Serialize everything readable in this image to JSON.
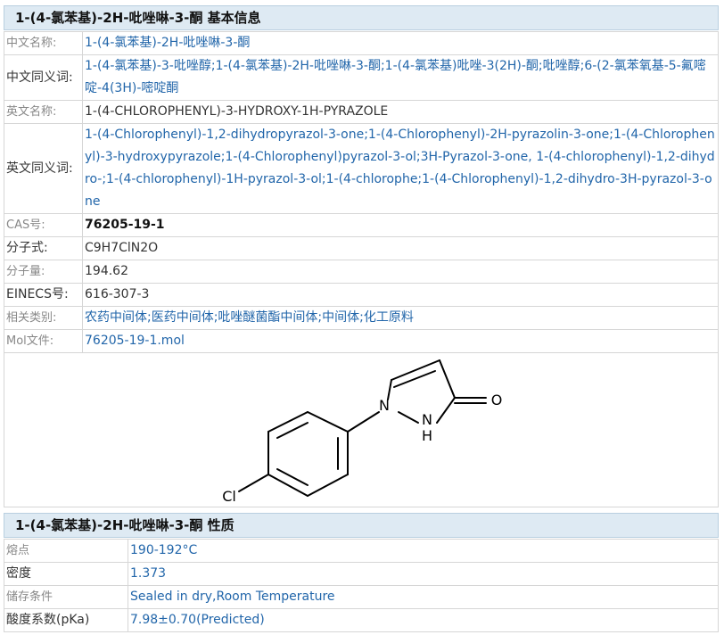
{
  "basic": {
    "title": "1-(4-氯苯基)-2H-吡唑啉-3-酮 基本信息",
    "rows": [
      {
        "label": "中文名称:",
        "value": "1-(4-氯苯基)-2H-吡唑啉-3-酮"
      },
      {
        "label": "中文同义词:",
        "value": "1-(4-氯苯基)-3-吡唑醇;1-(4-氯苯基)-2H-吡唑啉-3-酮;1-(4-氯苯基)吡唑-3(2H)-酮;吡唑醇;6-(2-氯苯氧基-5-氟嘧啶-4(3H)-嘧啶酮"
      },
      {
        "label": "英文名称:",
        "value": "1-(4-CHLOROPHENYL)-3-HYDROXY-1H-PYRAZOLE"
      },
      {
        "label": "英文同义词:",
        "value": "1-(4-Chlorophenyl)-1,2-dihydropyrazol-3-one;1-(4-Chlorophenyl)-2H-pyrazolin-3-one;1-(4-Chlorophenyl)-3-hydroxypyrazole;1-(4-Chlorophenyl)pyrazol-3-ol;3H-Pyrazol-3-one, 1-(4-chlorophenyl)-1,2-dihydro-;1-(4-chlorophenyl)-1H-pyrazol-3-ol;1-(4-chlorophe;1-(4-Chlorophenyl)-1,2-dihydro-3H-pyrazol-3-one"
      },
      {
        "label": "CAS号:",
        "value": "76205-19-1"
      },
      {
        "label": "分子式:",
        "value": "C9H7ClN2O"
      },
      {
        "label": "分子量:",
        "value": "194.62"
      },
      {
        "label": "EINECS号:",
        "value": "616-307-3"
      },
      {
        "label": "相关类别:",
        "value": "农药中间体;医药中间体;吡唑醚菌酯中间体;中间体;化工原料"
      },
      {
        "label": "Mol文件:",
        "value": "76205-19-1.mol"
      }
    ],
    "structure_atoms": {
      "n1": "N",
      "nh_n": "N",
      "nh_h": "H",
      "o": "O",
      "cl": "Cl"
    }
  },
  "properties": {
    "title": "1-(4-氯苯基)-2H-吡唑啉-3-酮 性质",
    "rows": [
      {
        "label": "熔点",
        "value": "190-192°C"
      },
      {
        "label": "密度",
        "value": "1.373"
      },
      {
        "label": "储存条件",
        "value": "Sealed in dry,Room Temperature"
      },
      {
        "label": "酸度系数(pKa)",
        "value": "7.98±0.70(Predicted)"
      }
    ]
  }
}
